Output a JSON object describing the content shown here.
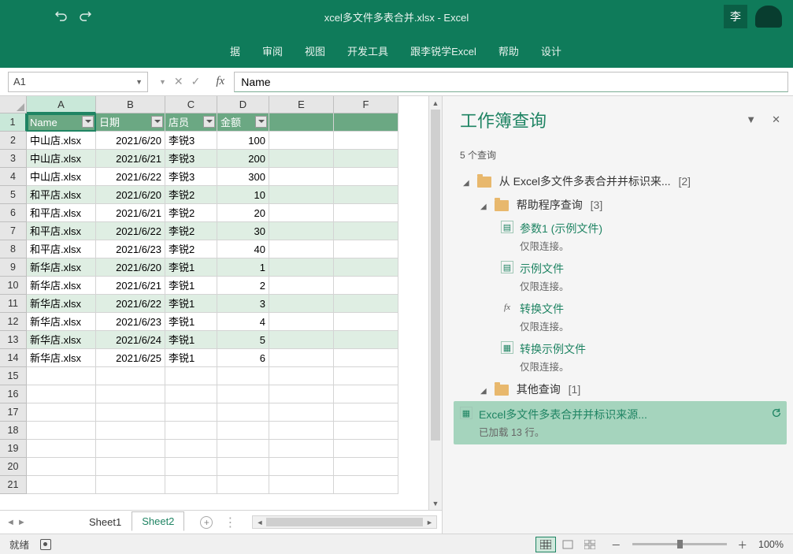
{
  "titlebar": {
    "title": "xcel多文件多表合并.xlsx - Excel",
    "user_initial": "李"
  },
  "ribbon": {
    "tabs": [
      "据",
      "审阅",
      "视图",
      "开发工具",
      "跟李锐学Excel",
      "帮助",
      "设计"
    ]
  },
  "formula_bar": {
    "cell_ref": "A1",
    "formula": "Name"
  },
  "columns": [
    "A",
    "B",
    "C",
    "D",
    "E",
    "F"
  ],
  "headers": [
    "Name",
    "日期",
    "店员",
    "金额"
  ],
  "rows": [
    {
      "name": "中山店.xlsx",
      "date": "2021/6/20",
      "clerk": "李锐3",
      "amt": "100"
    },
    {
      "name": "中山店.xlsx",
      "date": "2021/6/21",
      "clerk": "李锐3",
      "amt": "200"
    },
    {
      "name": "中山店.xlsx",
      "date": "2021/6/22",
      "clerk": "李锐3",
      "amt": "300"
    },
    {
      "name": "和平店.xlsx",
      "date": "2021/6/20",
      "clerk": "李锐2",
      "amt": "10"
    },
    {
      "name": "和平店.xlsx",
      "date": "2021/6/21",
      "clerk": "李锐2",
      "amt": "20"
    },
    {
      "name": "和平店.xlsx",
      "date": "2021/6/22",
      "clerk": "李锐2",
      "amt": "30"
    },
    {
      "name": "和平店.xlsx",
      "date": "2021/6/23",
      "clerk": "李锐2",
      "amt": "40"
    },
    {
      "name": "新华店.xlsx",
      "date": "2021/6/20",
      "clerk": "李锐1",
      "amt": "1"
    },
    {
      "name": "新华店.xlsx",
      "date": "2021/6/21",
      "clerk": "李锐1",
      "amt": "2"
    },
    {
      "name": "新华店.xlsx",
      "date": "2021/6/22",
      "clerk": "李锐1",
      "amt": "3"
    },
    {
      "name": "新华店.xlsx",
      "date": "2021/6/23",
      "clerk": "李锐1",
      "amt": "4"
    },
    {
      "name": "新华店.xlsx",
      "date": "2021/6/24",
      "clerk": "李锐1",
      "amt": "5"
    },
    {
      "name": "新华店.xlsx",
      "date": "2021/6/25",
      "clerk": "李锐1",
      "amt": "6"
    }
  ],
  "empty_rows": 7,
  "sheet_tabs": {
    "tabs": [
      "Sheet1",
      "Sheet2"
    ],
    "active": 1
  },
  "pane": {
    "title": "工作簿查询",
    "count_label": "5 个查询",
    "group1": {
      "label": "从 Excel多文件多表合并并标识来...",
      "count": "[2]"
    },
    "group2": {
      "label": "帮助程序查询",
      "count": "[3]"
    },
    "items": [
      {
        "icon": "param",
        "name": "参数1 (示例文件)",
        "desc": "仅限连接。"
      },
      {
        "icon": "doc",
        "name": "示例文件",
        "desc": "仅限连接。"
      },
      {
        "icon": "fx",
        "name": "转换文件",
        "desc": "仅限连接。"
      },
      {
        "icon": "table",
        "name": "转换示例文件",
        "desc": "仅限连接。"
      }
    ],
    "group3": {
      "label": "其他查询",
      "count": "[1]"
    },
    "selected": {
      "name": "Excel多文件多表合并并标识来源...",
      "desc": "已加载 13 行。"
    }
  },
  "statusbar": {
    "ready": "就绪",
    "zoom": "100%",
    "minus": "－",
    "plus": "＋"
  }
}
